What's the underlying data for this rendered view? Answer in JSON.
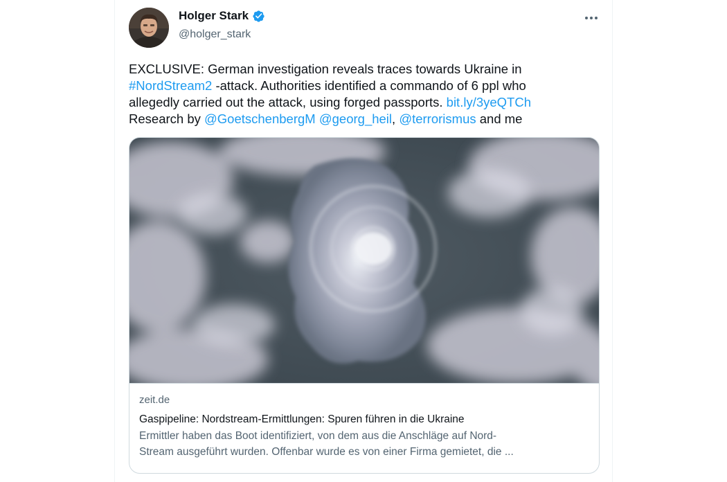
{
  "tweet": {
    "author": {
      "display_name": "Holger Stark",
      "handle": "@holger_stark",
      "verified": true,
      "avatar_icon": "user-portrait-avatar"
    },
    "more_icon": "more-options-icon",
    "text": {
      "line1": "EXCLUSIVE: German investigation reveals traces towards Ukraine in",
      "hashtag": "#NordStream2",
      "line2_rest": " -attack. Authorities identified a commando of 6 ppl who",
      "line3": "allegedly carried out the attack, using forged passports.  ",
      "short_link": "bit.ly/3yeQTCh",
      "line4_prefix": "Research by ",
      "mention1": "@GoetschenbergM",
      "sep1": " ",
      "mention2": "@georg_heil",
      "sep2": ", ",
      "mention3": "@terrorismus",
      "line4_suffix": " and me"
    },
    "link_card": {
      "image_icon": "satellite-image-gas-leak",
      "domain": "zeit.de",
      "title": "Gaspipeline: Nordstream-Ermittlungen: Spuren führen in die Ukraine",
      "description_line1": "Ermittler haben das Boot identifiziert, von dem aus die Anschläge auf Nord-",
      "description_line2": "Stream ausgeführt wurden. Offenbar wurde es von einer Firma gemietet, die ..."
    }
  },
  "colors": {
    "link": "#1d9bf0",
    "text": "#0f1419",
    "secondary": "#536471",
    "border": "#cfd9de"
  }
}
